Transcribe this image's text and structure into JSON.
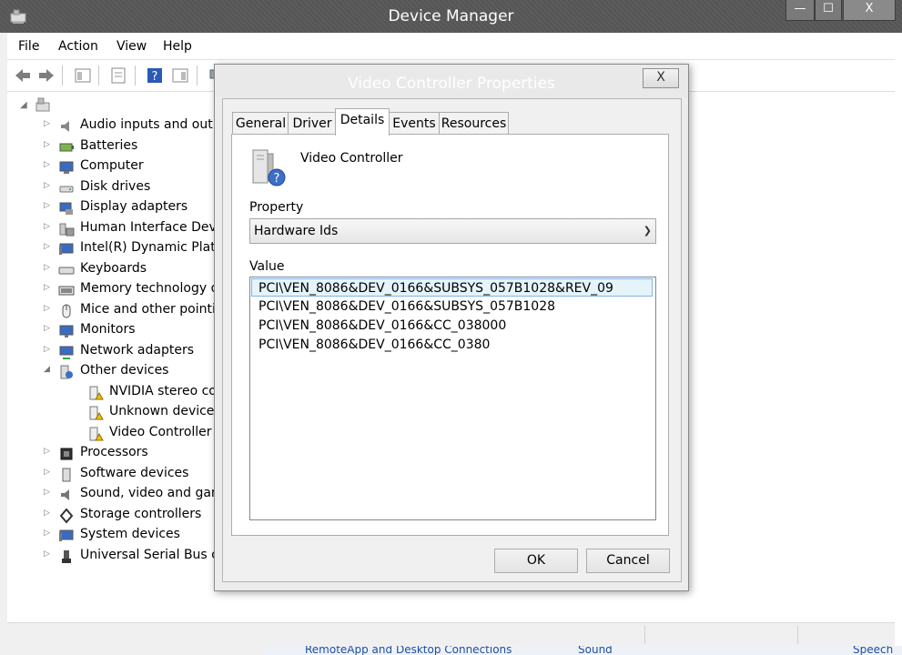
{
  "window": {
    "title": "Device Manager"
  },
  "title_buttons": {
    "minimize": "—",
    "maximize": "☐",
    "close": "X"
  },
  "menu": [
    "File",
    "Action",
    "View",
    "Help"
  ],
  "tree": {
    "items": [
      {
        "label": "Audio inputs and outputs",
        "icon": "speaker-icon",
        "expand": "▷"
      },
      {
        "label": "Batteries",
        "icon": "battery-icon",
        "expand": "▷"
      },
      {
        "label": "Computer",
        "icon": "computer-icon",
        "expand": "▷"
      },
      {
        "label": "Disk drives",
        "icon": "disk-drive-icon",
        "expand": "▷"
      },
      {
        "label": "Display adapters",
        "icon": "display-adapter-icon",
        "expand": "▷"
      },
      {
        "label": "Human Interface Devices",
        "icon": "hid-icon",
        "expand": "▷"
      },
      {
        "label": "Intel(R) Dynamic Platform",
        "icon": "intel-platform-icon",
        "expand": "▷"
      },
      {
        "label": "Keyboards",
        "icon": "keyboard-icon",
        "expand": "▷"
      },
      {
        "label": "Memory technology devices",
        "icon": "memory-icon",
        "expand": "▷"
      },
      {
        "label": "Mice and other pointing devices",
        "icon": "mouse-icon",
        "expand": "▷"
      },
      {
        "label": "Monitors",
        "icon": "monitor-icon",
        "expand": "▷"
      },
      {
        "label": "Network adapters",
        "icon": "network-adapter-icon",
        "expand": "▷"
      },
      {
        "label": "Other devices",
        "icon": "unknown-device-icon",
        "expand": "◢"
      },
      {
        "label": "NVIDIA stereo controller",
        "icon": "warning-device-icon",
        "expand": ""
      },
      {
        "label": "Unknown device",
        "icon": "warning-device-icon",
        "expand": ""
      },
      {
        "label": "Video Controller",
        "icon": "warning-device-icon",
        "expand": ""
      },
      {
        "label": "Processors",
        "icon": "processor-icon",
        "expand": "▷"
      },
      {
        "label": "Software devices",
        "icon": "software-device-icon",
        "expand": "▷"
      },
      {
        "label": "Sound, video and game controllers",
        "icon": "sound-icon",
        "expand": "▷"
      },
      {
        "label": "Storage controllers",
        "icon": "storage-icon",
        "expand": "▷"
      },
      {
        "label": "System devices",
        "icon": "system-device-icon",
        "expand": "▷"
      },
      {
        "label": "Universal Serial Bus controllers",
        "icon": "usb-icon",
        "expand": "▷"
      }
    ]
  },
  "background_taskbar": [
    "RemoteApp and Desktop Connections",
    "Sound",
    "Speech R"
  ],
  "dialog": {
    "title": "Video Controller Properties",
    "close": "X",
    "tabs": [
      "General",
      "Driver",
      "Details",
      "Events",
      "Resources"
    ],
    "active_tab": "Details",
    "device_name": "Video Controller",
    "property_label": "Property",
    "property_value": "Hardware Ids",
    "value_label": "Value",
    "values": [
      "PCI\\VEN_8086&DEV_0166&SUBSYS_057B1028&REV_09",
      "PCI\\VEN_8086&DEV_0166&SUBSYS_057B1028",
      "PCI\\VEN_8086&DEV_0166&CC_038000",
      "PCI\\VEN_8086&DEV_0166&CC_0380"
    ],
    "ok": "OK",
    "cancel": "Cancel"
  }
}
